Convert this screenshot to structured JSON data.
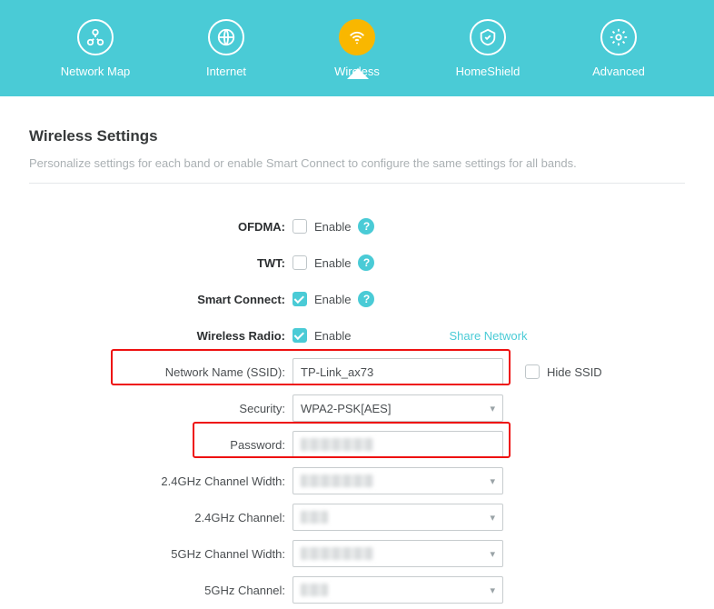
{
  "nav": {
    "items": [
      {
        "label": "Network Map"
      },
      {
        "label": "Internet"
      },
      {
        "label": "Wireless"
      },
      {
        "label": "HomeShield"
      },
      {
        "label": "Advanced"
      }
    ]
  },
  "page": {
    "title": "Wireless Settings",
    "description": "Personalize settings for each band or enable Smart Connect to configure the same settings for all bands."
  },
  "form": {
    "ofdma": {
      "label": "OFDMA:",
      "enable_text": "Enable",
      "checked": false
    },
    "twt": {
      "label": "TWT:",
      "enable_text": "Enable",
      "checked": false
    },
    "smart_connect": {
      "label": "Smart Connect:",
      "enable_text": "Enable",
      "checked": true
    },
    "wireless_radio": {
      "label": "Wireless Radio:",
      "enable_text": "Enable",
      "checked": true
    },
    "share_link": "Share Network",
    "ssid": {
      "label": "Network Name (SSID):",
      "value": "TP-Link_ax73"
    },
    "hide_ssid": {
      "label": "Hide SSID",
      "checked": false
    },
    "security": {
      "label": "Security:",
      "value": "WPA2-PSK[AES]"
    },
    "password": {
      "label": "Password:",
      "value": ""
    },
    "ch_width_24": {
      "label": "2.4GHz Channel Width:"
    },
    "ch_24": {
      "label": "2.4GHz Channel:"
    },
    "ch_width_5": {
      "label": "5GHz Channel Width:"
    },
    "ch_5": {
      "label": "5GHz Channel:"
    }
  }
}
